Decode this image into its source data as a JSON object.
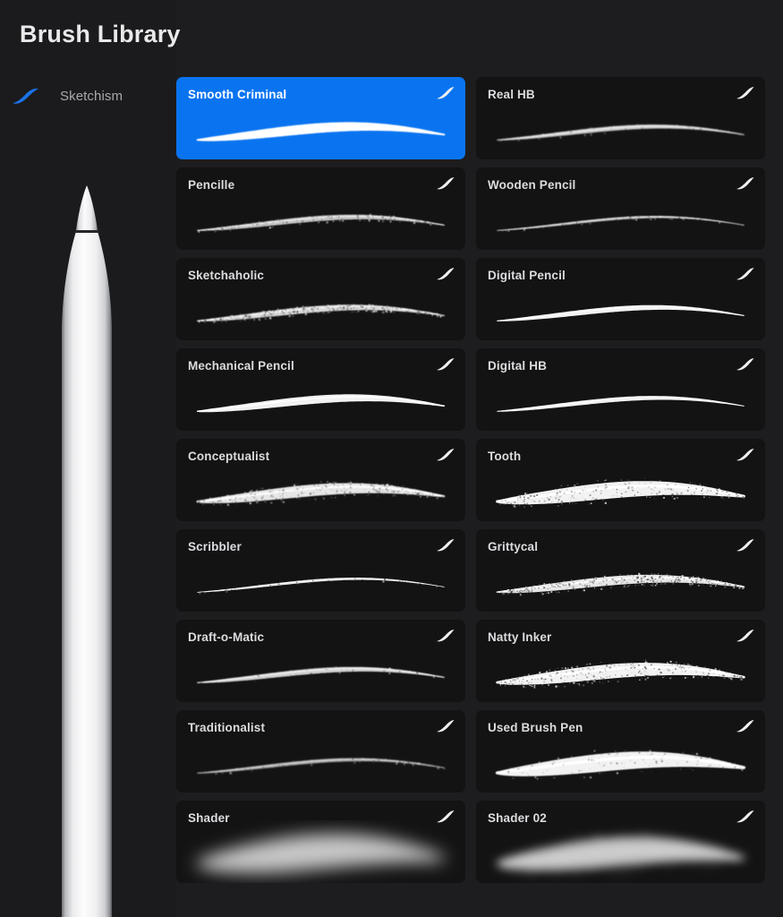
{
  "window": {
    "title": "Brush Library",
    "background_color": "#1d1d1f",
    "panel_color": "#1b1b1d",
    "card_color": "#131314",
    "accent_color": "#0a74f0",
    "text_color": "#dcdcdf",
    "muted_text_color": "#a9a9ad"
  },
  "sidebar": {
    "set": {
      "label": "Sketchism",
      "icon": "brush-stroke-icon",
      "icon_color": "#1a74e8"
    },
    "device_illustration": "apple-pencil-illustration"
  },
  "grid": {
    "columns": 2,
    "selected_index": 0,
    "badge_icon": "brush-stroke-badge-icon",
    "brushes": [
      {
        "name": "Smooth Criminal",
        "selected": true,
        "style": "smooth",
        "thickness": 11,
        "opacity": 1.0,
        "grain": 0.0,
        "blur": 0.4
      },
      {
        "name": "Real HB",
        "selected": false,
        "style": "smooth",
        "thickness": 5,
        "opacity": 0.85,
        "grain": 0.1,
        "blur": 0.7
      },
      {
        "name": "Pencille",
        "selected": false,
        "style": "pencil",
        "thickness": 6,
        "opacity": 0.8,
        "grain": 0.35,
        "blur": 0.6
      },
      {
        "name": "Wooden Pencil",
        "selected": false,
        "style": "fine",
        "thickness": 3,
        "opacity": 0.75,
        "grain": 0.15,
        "blur": 0.5
      },
      {
        "name": "Sketchaholic",
        "selected": false,
        "style": "rough",
        "thickness": 7,
        "opacity": 0.9,
        "grain": 0.7,
        "blur": 0.5
      },
      {
        "name": "Digital Pencil",
        "selected": false,
        "style": "smooth",
        "thickness": 6,
        "opacity": 1.0,
        "grain": 0.0,
        "blur": 0.2
      },
      {
        "name": "Mechanical Pencil",
        "selected": false,
        "style": "smooth",
        "thickness": 9,
        "opacity": 1.0,
        "grain": 0.05,
        "blur": 0.3
      },
      {
        "name": "Digital HB",
        "selected": false,
        "style": "smooth",
        "thickness": 5,
        "opacity": 1.0,
        "grain": 0.0,
        "blur": 0.2
      },
      {
        "name": "Conceptualist",
        "selected": false,
        "style": "chalk",
        "thickness": 13,
        "opacity": 0.95,
        "grain": 0.55,
        "blur": 0.4
      },
      {
        "name": "Tooth",
        "selected": false,
        "style": "chalk",
        "thickness": 18,
        "opacity": 1.0,
        "grain": 0.45,
        "blur": 0.3
      },
      {
        "name": "Scribbler",
        "selected": false,
        "style": "fine",
        "thickness": 3,
        "opacity": 0.95,
        "grain": 0.1,
        "blur": 0.2
      },
      {
        "name": "Grittycal",
        "selected": false,
        "style": "rough",
        "thickness": 10,
        "opacity": 0.95,
        "grain": 0.8,
        "blur": 0.3
      },
      {
        "name": "Draft-o-Matic",
        "selected": false,
        "style": "smooth",
        "thickness": 6,
        "opacity": 0.85,
        "grain": 0.1,
        "blur": 0.6
      },
      {
        "name": "Natty Inker",
        "selected": false,
        "style": "rough",
        "thickness": 16,
        "opacity": 1.0,
        "grain": 0.6,
        "blur": 0.3
      },
      {
        "name": "Traditionalist",
        "selected": false,
        "style": "fine",
        "thickness": 4,
        "opacity": 0.7,
        "grain": 0.15,
        "blur": 0.8
      },
      {
        "name": "Used Brush Pen",
        "selected": false,
        "style": "ink",
        "thickness": 20,
        "opacity": 1.0,
        "grain": 0.2,
        "blur": 0.5
      },
      {
        "name": "Shader",
        "selected": false,
        "style": "airbrush",
        "thickness": 42,
        "opacity": 0.85,
        "grain": 0.25,
        "blur": 9.0
      },
      {
        "name": "Shader 02",
        "selected": false,
        "style": "airbrush",
        "thickness": 34,
        "opacity": 0.9,
        "grain": 0.5,
        "blur": 5.0
      }
    ]
  }
}
